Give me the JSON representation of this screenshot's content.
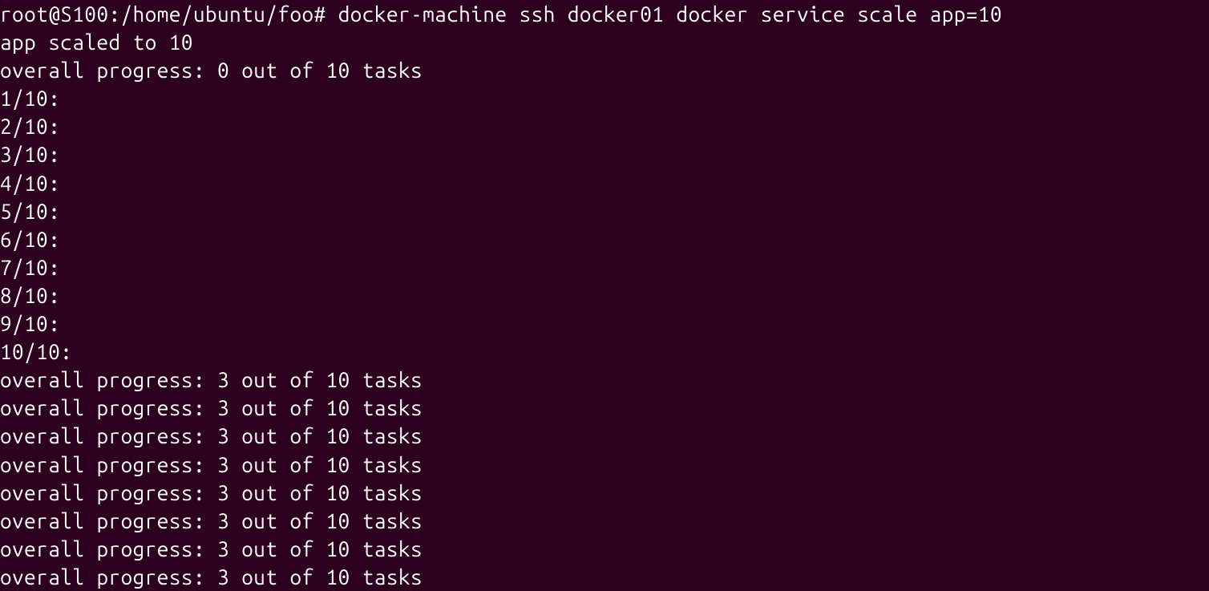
{
  "prompt": {
    "user_host": "root@S100",
    "path": "/home/ubuntu/foo",
    "symbol": "#",
    "command": "docker-machine ssh docker01 docker service scale app=10"
  },
  "output": {
    "scaled_msg": "app scaled to 10",
    "progress_initial": "overall progress: 0 out of 10 tasks",
    "tasks": [
      "1/10:",
      "2/10:",
      "3/10:",
      "4/10:",
      "5/10:",
      "6/10:",
      "7/10:",
      "8/10:",
      "9/10:",
      "10/10:"
    ],
    "progress_updates": [
      "overall progress: 3 out of 10 tasks",
      "overall progress: 3 out of 10 tasks",
      "overall progress: 3 out of 10 tasks",
      "overall progress: 3 out of 10 tasks",
      "overall progress: 3 out of 10 tasks",
      "overall progress: 3 out of 10 tasks",
      "overall progress: 3 out of 10 tasks",
      "overall progress: 3 out of 10 tasks"
    ]
  }
}
